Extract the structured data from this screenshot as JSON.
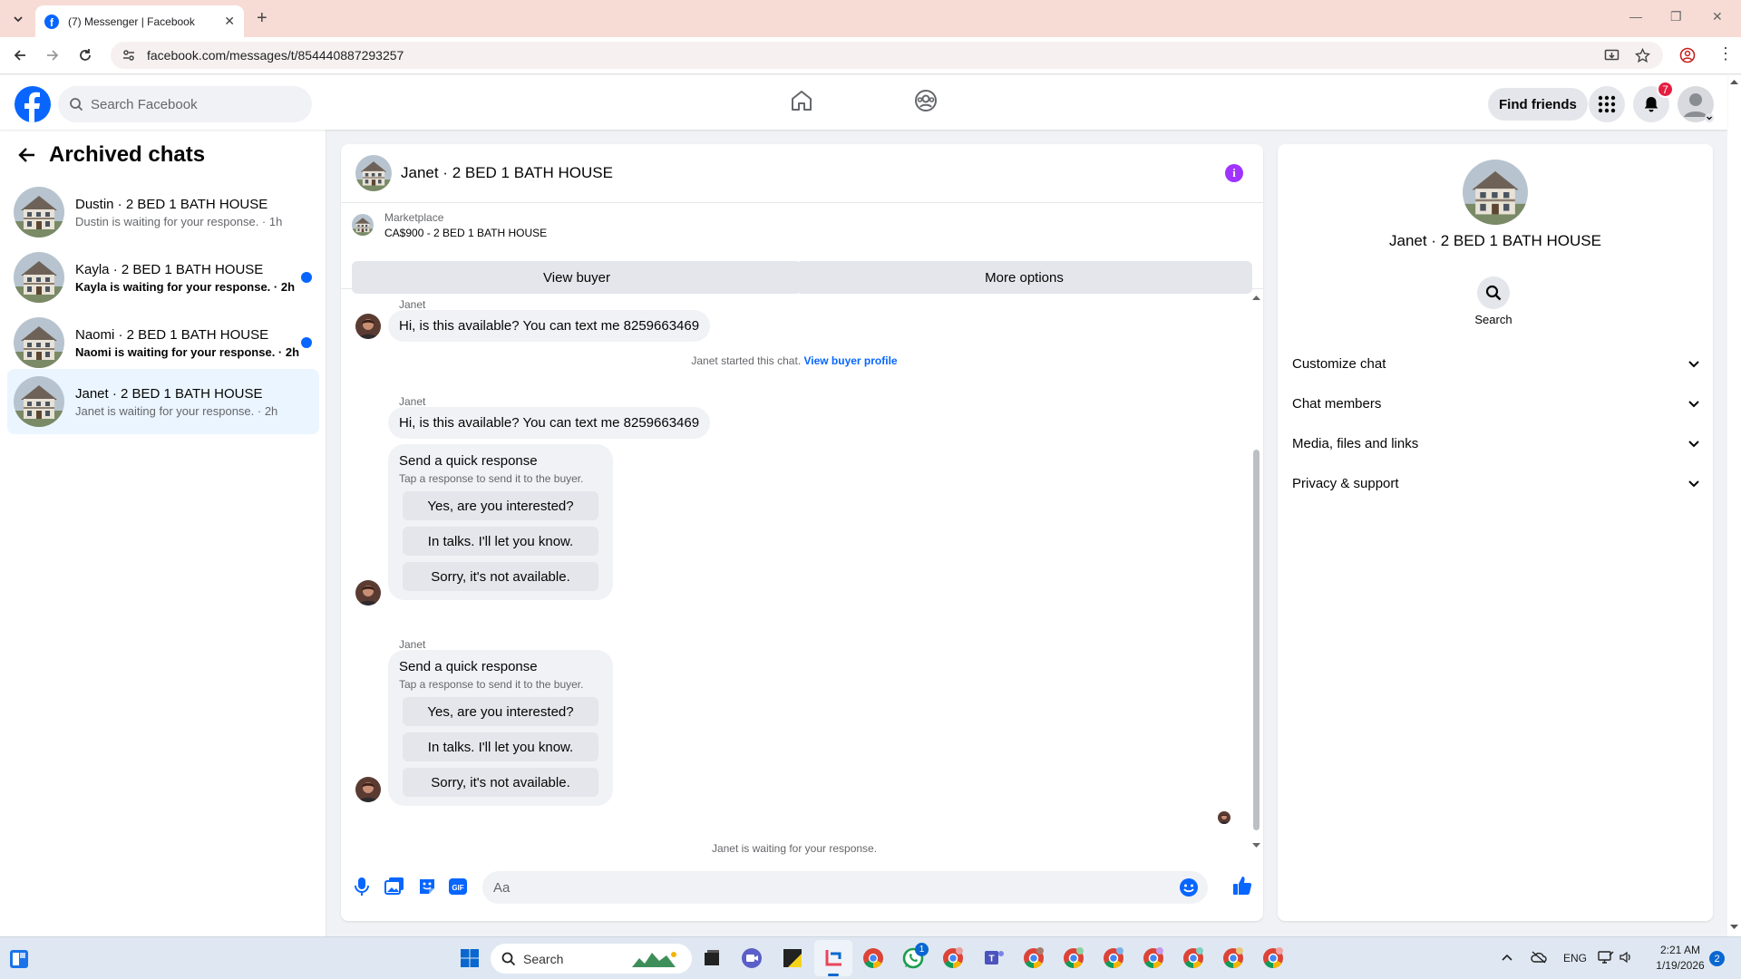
{
  "browser": {
    "tab_title": "(7) Messenger | Facebook",
    "url": "facebook.com/messages/t/854440887293257"
  },
  "header": {
    "search_placeholder": "Search Facebook",
    "find_friends": "Find friends",
    "notification_count": "7"
  },
  "sidebar": {
    "title": "Archived chats",
    "chats": [
      {
        "name": "Dustin · 2 BED 1 BATH HOUSE",
        "preview": "Dustin is waiting for your response. · 1h",
        "unread": false,
        "active": false
      },
      {
        "name": "Kayla · 2 BED 1 BATH HOUSE",
        "preview": "Kayla is waiting for your response. · 2h",
        "unread": true,
        "active": false
      },
      {
        "name": "Naomi · 2 BED 1 BATH HOUSE",
        "preview": "Naomi is waiting for your response. · 2h",
        "unread": true,
        "active": false
      },
      {
        "name": "Janet · 2 BED 1 BATH HOUSE",
        "preview": "Janet is waiting for your response. · 2h",
        "unread": false,
        "active": true
      }
    ]
  },
  "conversation": {
    "title": "Janet · 2 BED 1 BATH HOUSE",
    "marketplace_label": "Marketplace",
    "listing": "CA$900 - 2 BED 1 BATH HOUSE",
    "view_buyer": "View buyer",
    "more_options": "More options",
    "sender": "Janet",
    "message_text": "Hi, is this available? You can text me 8259663469",
    "started_text": "Janet started this chat.",
    "view_buyer_profile": "View buyer profile",
    "quick_title": "Send a quick response",
    "quick_subtitle": "Tap a response to send it to the buyer.",
    "quick_options": [
      "Yes, are you interested?",
      "In talks. I'll let you know.",
      "Sorry, it's not available."
    ],
    "waiting_text": "Janet is waiting for your response.",
    "input_placeholder": "Aa"
  },
  "details": {
    "name": "Janet · 2 BED 1 BATH HOUSE",
    "search_label": "Search",
    "sections": [
      "Customize chat",
      "Chat members",
      "Media, files and links",
      "Privacy & support"
    ]
  },
  "taskbar": {
    "search_label": "Search",
    "lang": "ENG",
    "time": "2:21 AM",
    "date": "1/19/2026",
    "notif_count": "2",
    "whatsapp_badge": "1"
  },
  "colors": {
    "fb_blue": "#0866ff",
    "info_purple": "#a033ff",
    "badge_red": "#e41e3f"
  }
}
